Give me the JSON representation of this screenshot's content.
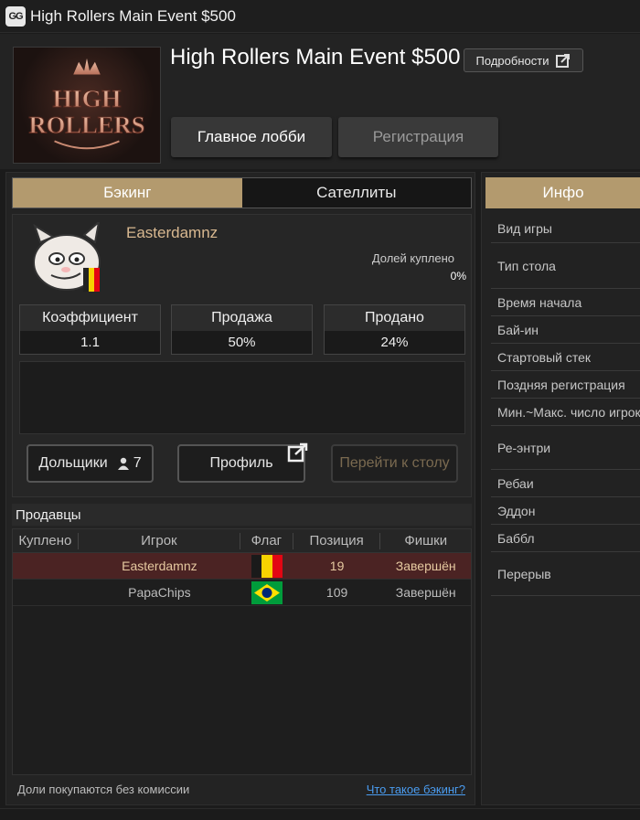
{
  "window": {
    "app_logo_text": "GG",
    "title": "High Rollers Main Event $500"
  },
  "header": {
    "logo": {
      "line1": "HIGH",
      "line2": "ROLLERS"
    },
    "event_title": "High Rollers Main Event $500",
    "details_label": "Подробности",
    "lobby_label": "Главное лобби",
    "register_label": "Регистрация"
  },
  "tabs": {
    "backing": "Бэкинг",
    "satellites": "Сателлиты"
  },
  "backer": {
    "name": "Easterdamnz",
    "shares_bought_label": "Долей куплено",
    "shares_bought_value": "0%",
    "stats": [
      {
        "label": "Коэффициент",
        "value": "1.1"
      },
      {
        "label": "Продажа",
        "value": "50%"
      },
      {
        "label": "Продано",
        "value": "24%"
      }
    ],
    "buttons": {
      "shareholders": "Дольщики",
      "shareholders_count": "7",
      "profile": "Профиль",
      "goto_table": "Перейти к столу"
    }
  },
  "sellers": {
    "title": "Продавцы",
    "columns": [
      "Куплено",
      "Игрок",
      "Флаг",
      "Позиция",
      "Фишки"
    ],
    "rows": [
      {
        "bought": "",
        "player": "Easterdamnz",
        "flag": "belgium-flag",
        "position": "19",
        "chips": "Завершён"
      },
      {
        "bought": "",
        "player": "PapaChips",
        "flag": "brazil-flag",
        "position": "109",
        "chips": "Завершён"
      }
    ]
  },
  "footer": {
    "note": "Доли покупаются без комиссии",
    "link": "Что такое бэкинг?"
  },
  "info": {
    "tab_label": "Инфо",
    "rows": [
      "Вид игры",
      "Тип стола",
      "Время начала",
      "Бай-ин",
      "Стартовый стек",
      "Поздняя регистрация",
      "Мин.~Макс. число игроков",
      "Ре-энтри",
      "Ребаи",
      "Эддон",
      "Баббл",
      "Перерыв"
    ]
  },
  "colors": {
    "accent_tab": "#b39a6e",
    "selected_row": "#4b2323",
    "link": "#4a9cf0",
    "name_gold": "#d8b890"
  }
}
